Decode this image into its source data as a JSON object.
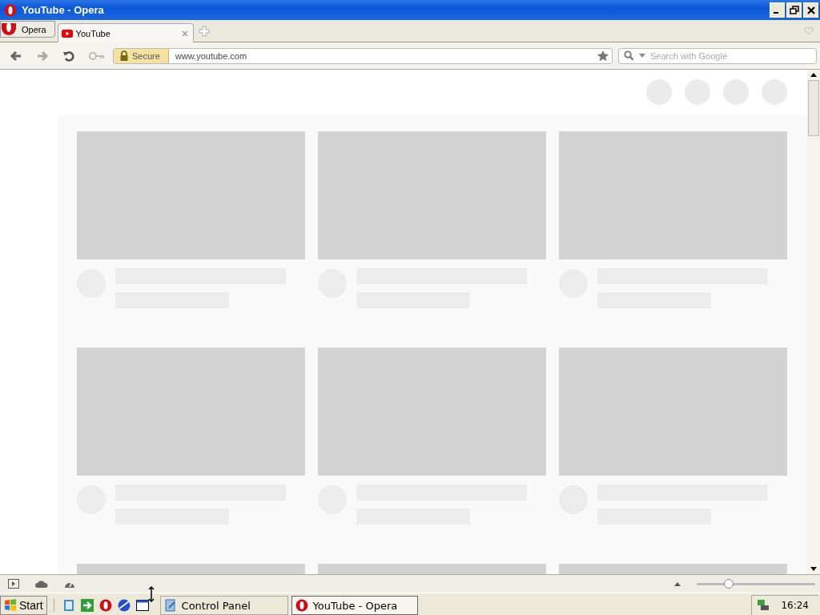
{
  "window": {
    "title": "YouTube - Opera"
  },
  "menu_button": {
    "label": "Opera"
  },
  "tabs": [
    {
      "label": "YouTube",
      "selected": true
    }
  ],
  "address_bar": {
    "security_label": "Secure",
    "url": "www.youtube.com"
  },
  "search": {
    "placeholder": "Search with Google"
  },
  "status_bar": {
    "zoom": {
      "level": 0.27
    }
  },
  "taskbar": {
    "start": "Start",
    "tasks": [
      {
        "label": "Control Panel",
        "selected": false
      },
      {
        "label": "YouTube - Opera",
        "selected": true
      }
    ],
    "clock": "16:24"
  }
}
